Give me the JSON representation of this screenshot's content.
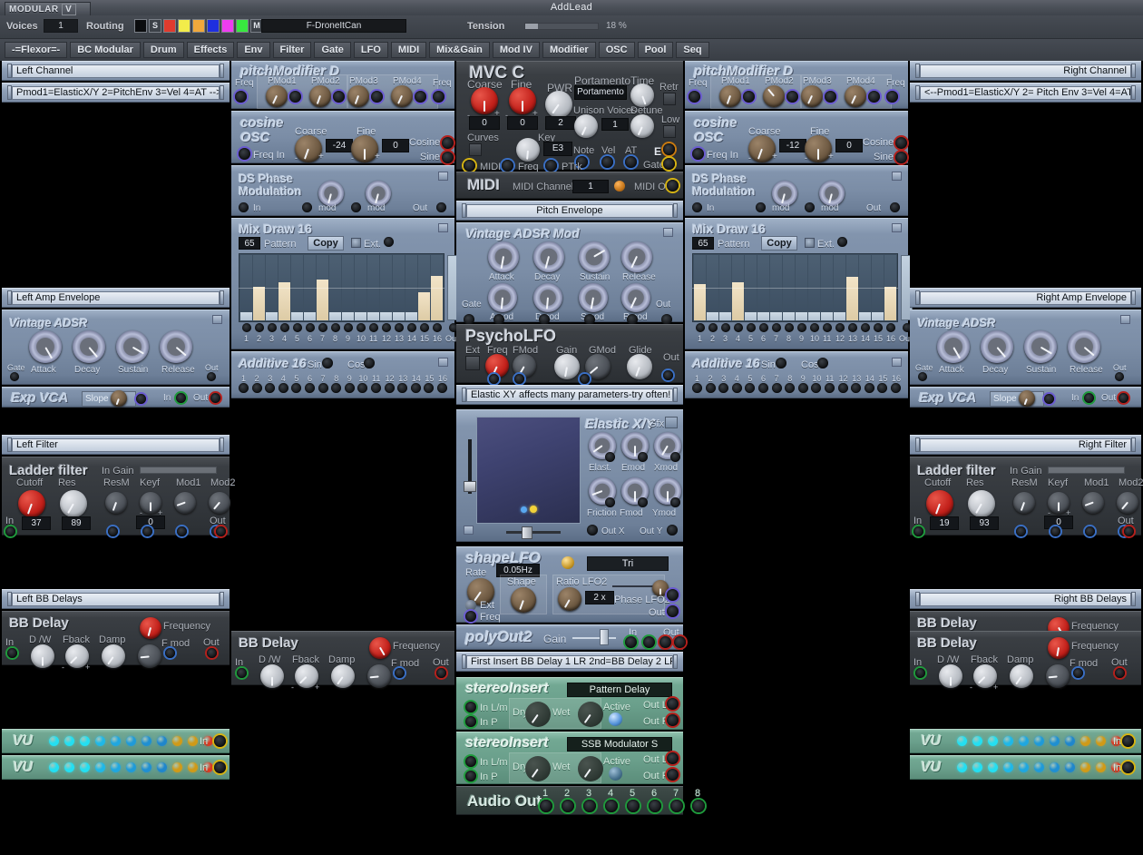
{
  "titlebar": {
    "title": "AddLead",
    "logo_text": "MODULAR",
    "logo_v": "V"
  },
  "toolbar": {
    "voices_label": "Voices",
    "voices_value": "1",
    "routing_label": "Routing",
    "routing_solo": "S",
    "routing_mute": "M",
    "routing_colors": [
      "#0b0c0e",
      "#3c4148",
      "#e03b2e",
      "#f2ec4a",
      "#f0a83c",
      "#1f2fe0",
      "#ee3df0",
      "#38e83f",
      "#6c7178"
    ],
    "preset_name": "F-DroneItCan",
    "tension_label": "Tension",
    "tension_value": 18,
    "tension_pct": "18 %"
  },
  "tabs": [
    "-=Flexor=-",
    "BC Modular",
    "Drum",
    "Effects",
    "Env",
    "Filter",
    "Gate",
    "LFO",
    "MIDI",
    "Mix&Gain",
    "Mod IV",
    "Modifier",
    "OSC",
    "Pool",
    "Seq"
  ],
  "left_column": {
    "channel_strip": "Left Channel",
    "note_strip": "Pmod1=ElasticX/Y 2=PitchEnv 3=Vel 4=AT -->",
    "amp_env_strip": "Left Amp Envelope",
    "adsr": {
      "title": "Vintage ADSR",
      "gate": "Gate",
      "out": "Out",
      "knobs": [
        "Attack",
        "Decay",
        "Sustain",
        "Release"
      ]
    },
    "vca": {
      "title": "Exp VCA",
      "slope": "Slope",
      "in": "In",
      "out": "Out"
    },
    "filter_strip": "Left Filter",
    "ladder": {
      "title": "Ladder filter",
      "in_gain": "In Gain",
      "knob_labels": [
        "Cutoff",
        "Res",
        "ResM",
        "Keyf",
        "Mod1",
        "Mod2"
      ],
      "cutoff": "37",
      "res": "89",
      "keyf": "0",
      "in": "In",
      "out": "Out",
      "minus": "-",
      "plus": "+"
    },
    "bbdelay_strip": "Left BB Delays",
    "bbdelay": {
      "title": "BB Delay",
      "in": "In",
      "out": "Out",
      "labels": [
        "D /W",
        "Fback",
        "Damp"
      ],
      "frequency": "Frequency",
      "fmod": "F mod",
      "minus": "-",
      "plus": "+"
    },
    "vu": {
      "title": "VU",
      "in": "In"
    }
  },
  "mid_left_column": {
    "pitchmod": {
      "title": "pitchModifier D",
      "freq_left": "Freq",
      "freq_right": "Freq",
      "knobs": [
        "PMod1",
        "PMod2",
        "PMod3",
        "PMod4"
      ]
    },
    "cosine": {
      "title_1": "cosine",
      "title_2": "OSC",
      "coarse_label": "Coarse",
      "fine_label": "Fine",
      "coarse": "-24",
      "fine": "0",
      "freq_in": "Freq In",
      "out_cosine": "Cosine",
      "out_sine": "Sine",
      "minus": "-",
      "plus": "+"
    },
    "dsphase": {
      "title_1": "DS Phase",
      "title_2": "Modulation",
      "in": "In",
      "mod1": "mod",
      "mod2": "mod",
      "out": "Out"
    },
    "mixdraw": {
      "title": "Mix Draw 16",
      "pattern_value": "65",
      "pattern_label": "Pattern",
      "copy": "Copy",
      "ext": "Ext.",
      "out": "Out",
      "steps": [
        "1",
        "2",
        "3",
        "4",
        "5",
        "6",
        "7",
        "8",
        "9",
        "10",
        "11",
        "12",
        "13",
        "14",
        "15",
        "16"
      ],
      "values": [
        12,
        52,
        12,
        58,
        12,
        12,
        62,
        12,
        12,
        12,
        12,
        12,
        12,
        12,
        43,
        68
      ]
    },
    "additive": {
      "title": "Additive 16",
      "sin": "Sin",
      "cos": "Cos",
      "steps": [
        "1",
        "2",
        "3",
        "4",
        "5",
        "6",
        "7",
        "8",
        "9",
        "10",
        "11",
        "12",
        "13",
        "14",
        "15",
        "16"
      ]
    }
  },
  "center_column": {
    "mvc": {
      "title": "MVC C",
      "coarse_label": "Coarse",
      "coarse_value": "0",
      "fine_label": "Fine",
      "fine_value": "0",
      "pwr_label": "PWR",
      "pwr_value": "2",
      "portamento_label": "Portamento",
      "portamento_value": "Portamento",
      "time_label": "Time",
      "retr_label": "Retr",
      "unison_label": "Unison Voices",
      "unison_value": "1",
      "detune_label": "Detune",
      "low_label": "Low",
      "curves_label": "Curves",
      "key_label": "Key",
      "key_value": "E3",
      "note": "Note",
      "vel": "Vel",
      "at": "AT",
      "e": "E",
      "gate": "Gate",
      "midi": "MIDI",
      "freq": "Freq",
      "ptrk": "PTrk",
      "minus": "-",
      "plus": "+"
    },
    "midi": {
      "title": "MIDI",
      "channel_label": "MIDI Channel",
      "channel_value": "1",
      "midi_out": "MIDI Out"
    },
    "pitch_env_strip": "Pitch Envelope",
    "adsrmod": {
      "title": "Vintage ADSR Mod",
      "gate": "Gate",
      "out": "Out",
      "row1": [
        "Attack",
        "Decay",
        "Sustain",
        "Release"
      ],
      "row2": [
        "Amod",
        "Dmod",
        "Smod",
        "Rmod"
      ]
    },
    "psycholfo": {
      "title": "PsychoLFO",
      "ext": "Ext",
      "freq": "Freq",
      "fmod": "FMod",
      "gain": "Gain",
      "gmod": "GMod",
      "glide": "Glide",
      "out": "Out"
    },
    "elastic_note": "Elastic XY affects many parameters-try often!",
    "elastic": {
      "title": "Elastic X/Y",
      "gfx": "Gfx",
      "row1": [
        "Elast.",
        "Emod",
        "Xmod"
      ],
      "row2": [
        "Friction",
        "Fmod",
        "Ymod"
      ],
      "out_x": "Out X",
      "out_y": "Out Y"
    },
    "shapelfo": {
      "title": "shapeLFO",
      "rate_label": "Rate",
      "rate_value": "0.05Hz",
      "wave": "Tri",
      "shape_label": "Shape",
      "ratio_label": "Ratio LFO2",
      "ratio_value": "2 x",
      "phase_label": "Phase LFO2",
      "ext": "Ext",
      "freq": "Freq",
      "out": "Out"
    },
    "polyout": {
      "title": "polyOut2",
      "gain": "Gain",
      "in": "In",
      "out": "Out"
    },
    "insert_note": "First Insert BB Delay 1 LR 2nd=BB Delay 2 LR",
    "inserts": [
      {
        "title": "stereoInsert",
        "name": "Pattern Delay",
        "in_lm": "In L/m",
        "in_r": "In P",
        "dry": "Dry",
        "wet": "Wet",
        "active": "Active",
        "out_l": "Out L",
        "out_r": "Out R",
        "active_on": true
      },
      {
        "title": "stereoInsert",
        "name": "SSB Modulator S",
        "in_lm": "In L/m",
        "in_r": "In P",
        "dry": "Dry",
        "wet": "Wet",
        "active": "Active",
        "out_l": "Out L",
        "out_r": "Out R",
        "active_on": false
      }
    ],
    "audio_out": {
      "title": "Audio Out",
      "channels": [
        "1",
        "2",
        "3",
        "4",
        "5",
        "6",
        "7",
        "8"
      ]
    }
  },
  "mid_right_column": {
    "pitchmod": {
      "title": "pitchModifier D",
      "freq_left": "Freq",
      "freq_right": "Freq",
      "knobs": [
        "PMod1",
        "PMod2",
        "PMod3",
        "PMod4"
      ]
    },
    "cosine": {
      "title_1": "cosine",
      "title_2": "OSC",
      "coarse_label": "Coarse",
      "fine_label": "Fine",
      "coarse": "-12",
      "fine": "0",
      "freq_in": "Freq In",
      "out_cosine": "Cosine",
      "out_sine": "Sine",
      "minus": "-",
      "plus": "+"
    },
    "dsphase": {
      "title_1": "DS Phase",
      "title_2": "Modulation",
      "in": "In",
      "mod1": "mod",
      "mod2": "mod",
      "out": "Out"
    },
    "mixdraw": {
      "title": "Mix Draw 16",
      "pattern_value": "65",
      "pattern_label": "Pattern",
      "copy": "Copy",
      "ext": "Ext.",
      "out": "Out",
      "steps": [
        "1",
        "2",
        "3",
        "4",
        "5",
        "6",
        "7",
        "8",
        "9",
        "10",
        "11",
        "12",
        "13",
        "14",
        "15",
        "16"
      ],
      "values": [
        55,
        12,
        12,
        58,
        12,
        12,
        12,
        12,
        12,
        12,
        12,
        12,
        66,
        12,
        12,
        52
      ]
    },
    "additive": {
      "title": "Additive 16",
      "sin": "Sin",
      "cos": "Cos",
      "steps": [
        "1",
        "2",
        "3",
        "4",
        "5",
        "6",
        "7",
        "8",
        "9",
        "10",
        "11",
        "12",
        "13",
        "14",
        "15",
        "16"
      ]
    }
  },
  "right_column": {
    "channel_strip": "Right Channel",
    "note_strip": "<--Pmod1=ElasticX/Y 2= Pitch Env 3=Vel 4=AT",
    "amp_env_strip": "Right Amp Envelope",
    "adsr": {
      "title": "Vintage ADSR",
      "gate": "Gate",
      "out": "Out",
      "knobs": [
        "Attack",
        "Decay",
        "Sustain",
        "Release"
      ]
    },
    "vca": {
      "title": "Exp VCA",
      "slope": "Slope",
      "in": "In",
      "out": "Out"
    },
    "filter_strip": "Right Filter",
    "ladder": {
      "title": "Ladder filter",
      "in_gain": "In Gain",
      "knob_labels": [
        "Cutoff",
        "Res",
        "ResM",
        "Keyf",
        "Mod1",
        "Mod2"
      ],
      "cutoff": "19",
      "res": "93",
      "keyf": "0",
      "in": "In",
      "out": "Out",
      "minus": "-",
      "plus": "+"
    },
    "bbdelay_strip": "Right BB Delays",
    "bbdelay": {
      "title": "BB Delay",
      "in": "In",
      "out": "Out",
      "labels": [
        "D /W",
        "Fback",
        "Damp"
      ],
      "frequency": "Frequency",
      "fmod": "F mod",
      "minus": "-",
      "plus": "+"
    },
    "vu": {
      "title": "VU",
      "in": "In"
    }
  }
}
